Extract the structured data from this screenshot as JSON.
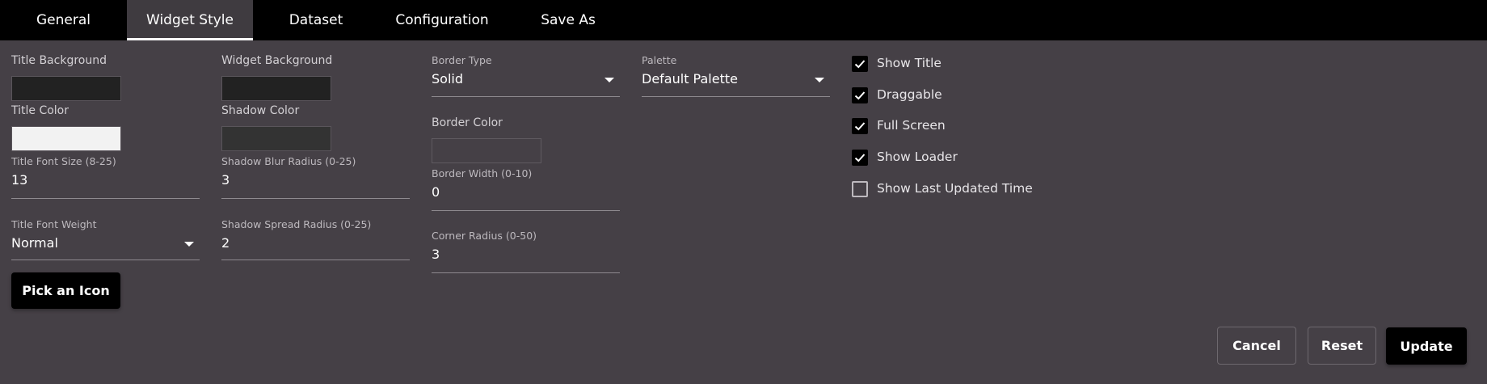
{
  "tabs": {
    "general": "General",
    "widget_style": "Widget Style",
    "dataset": "Dataset",
    "configuration": "Configuration",
    "save_as": "Save As"
  },
  "col1": {
    "title_background_label": "Title Background",
    "title_background_color": "#222222",
    "title_color_label": "Title Color",
    "title_color_value": "#f2f2f2",
    "title_font_size_label": "Title Font Size (8-25)",
    "title_font_size_value": "13",
    "title_font_weight_label": "Title Font Weight",
    "title_font_weight_value": "Normal",
    "pick_icon_label": "Pick an Icon"
  },
  "col2": {
    "widget_background_label": "Widget Background",
    "widget_background_color": "#222222",
    "shadow_color_label": "Shadow Color",
    "shadow_color_value": "#333333",
    "shadow_blur_label": "Shadow Blur Radius (0-25)",
    "shadow_blur_value": "3",
    "shadow_spread_label": "Shadow Spread Radius (0-25)",
    "shadow_spread_value": "2"
  },
  "col3": {
    "border_type_label": "Border Type",
    "border_type_value": "Solid",
    "border_color_label": "Border Color",
    "border_color_value": "#454046",
    "border_width_label": "Border Width (0-10)",
    "border_width_value": "0",
    "corner_radius_label": "Corner Radius (0-50)",
    "corner_radius_value": "3"
  },
  "col4": {
    "palette_label": "Palette",
    "palette_value": "Default Palette"
  },
  "options": {
    "show_title": "Show Title",
    "draggable": "Draggable",
    "full_screen": "Full Screen",
    "show_loader": "Show Loader",
    "show_last_updated": "Show Last Updated Time"
  },
  "actions": {
    "cancel": "Cancel",
    "reset": "Reset",
    "update": "Update"
  }
}
